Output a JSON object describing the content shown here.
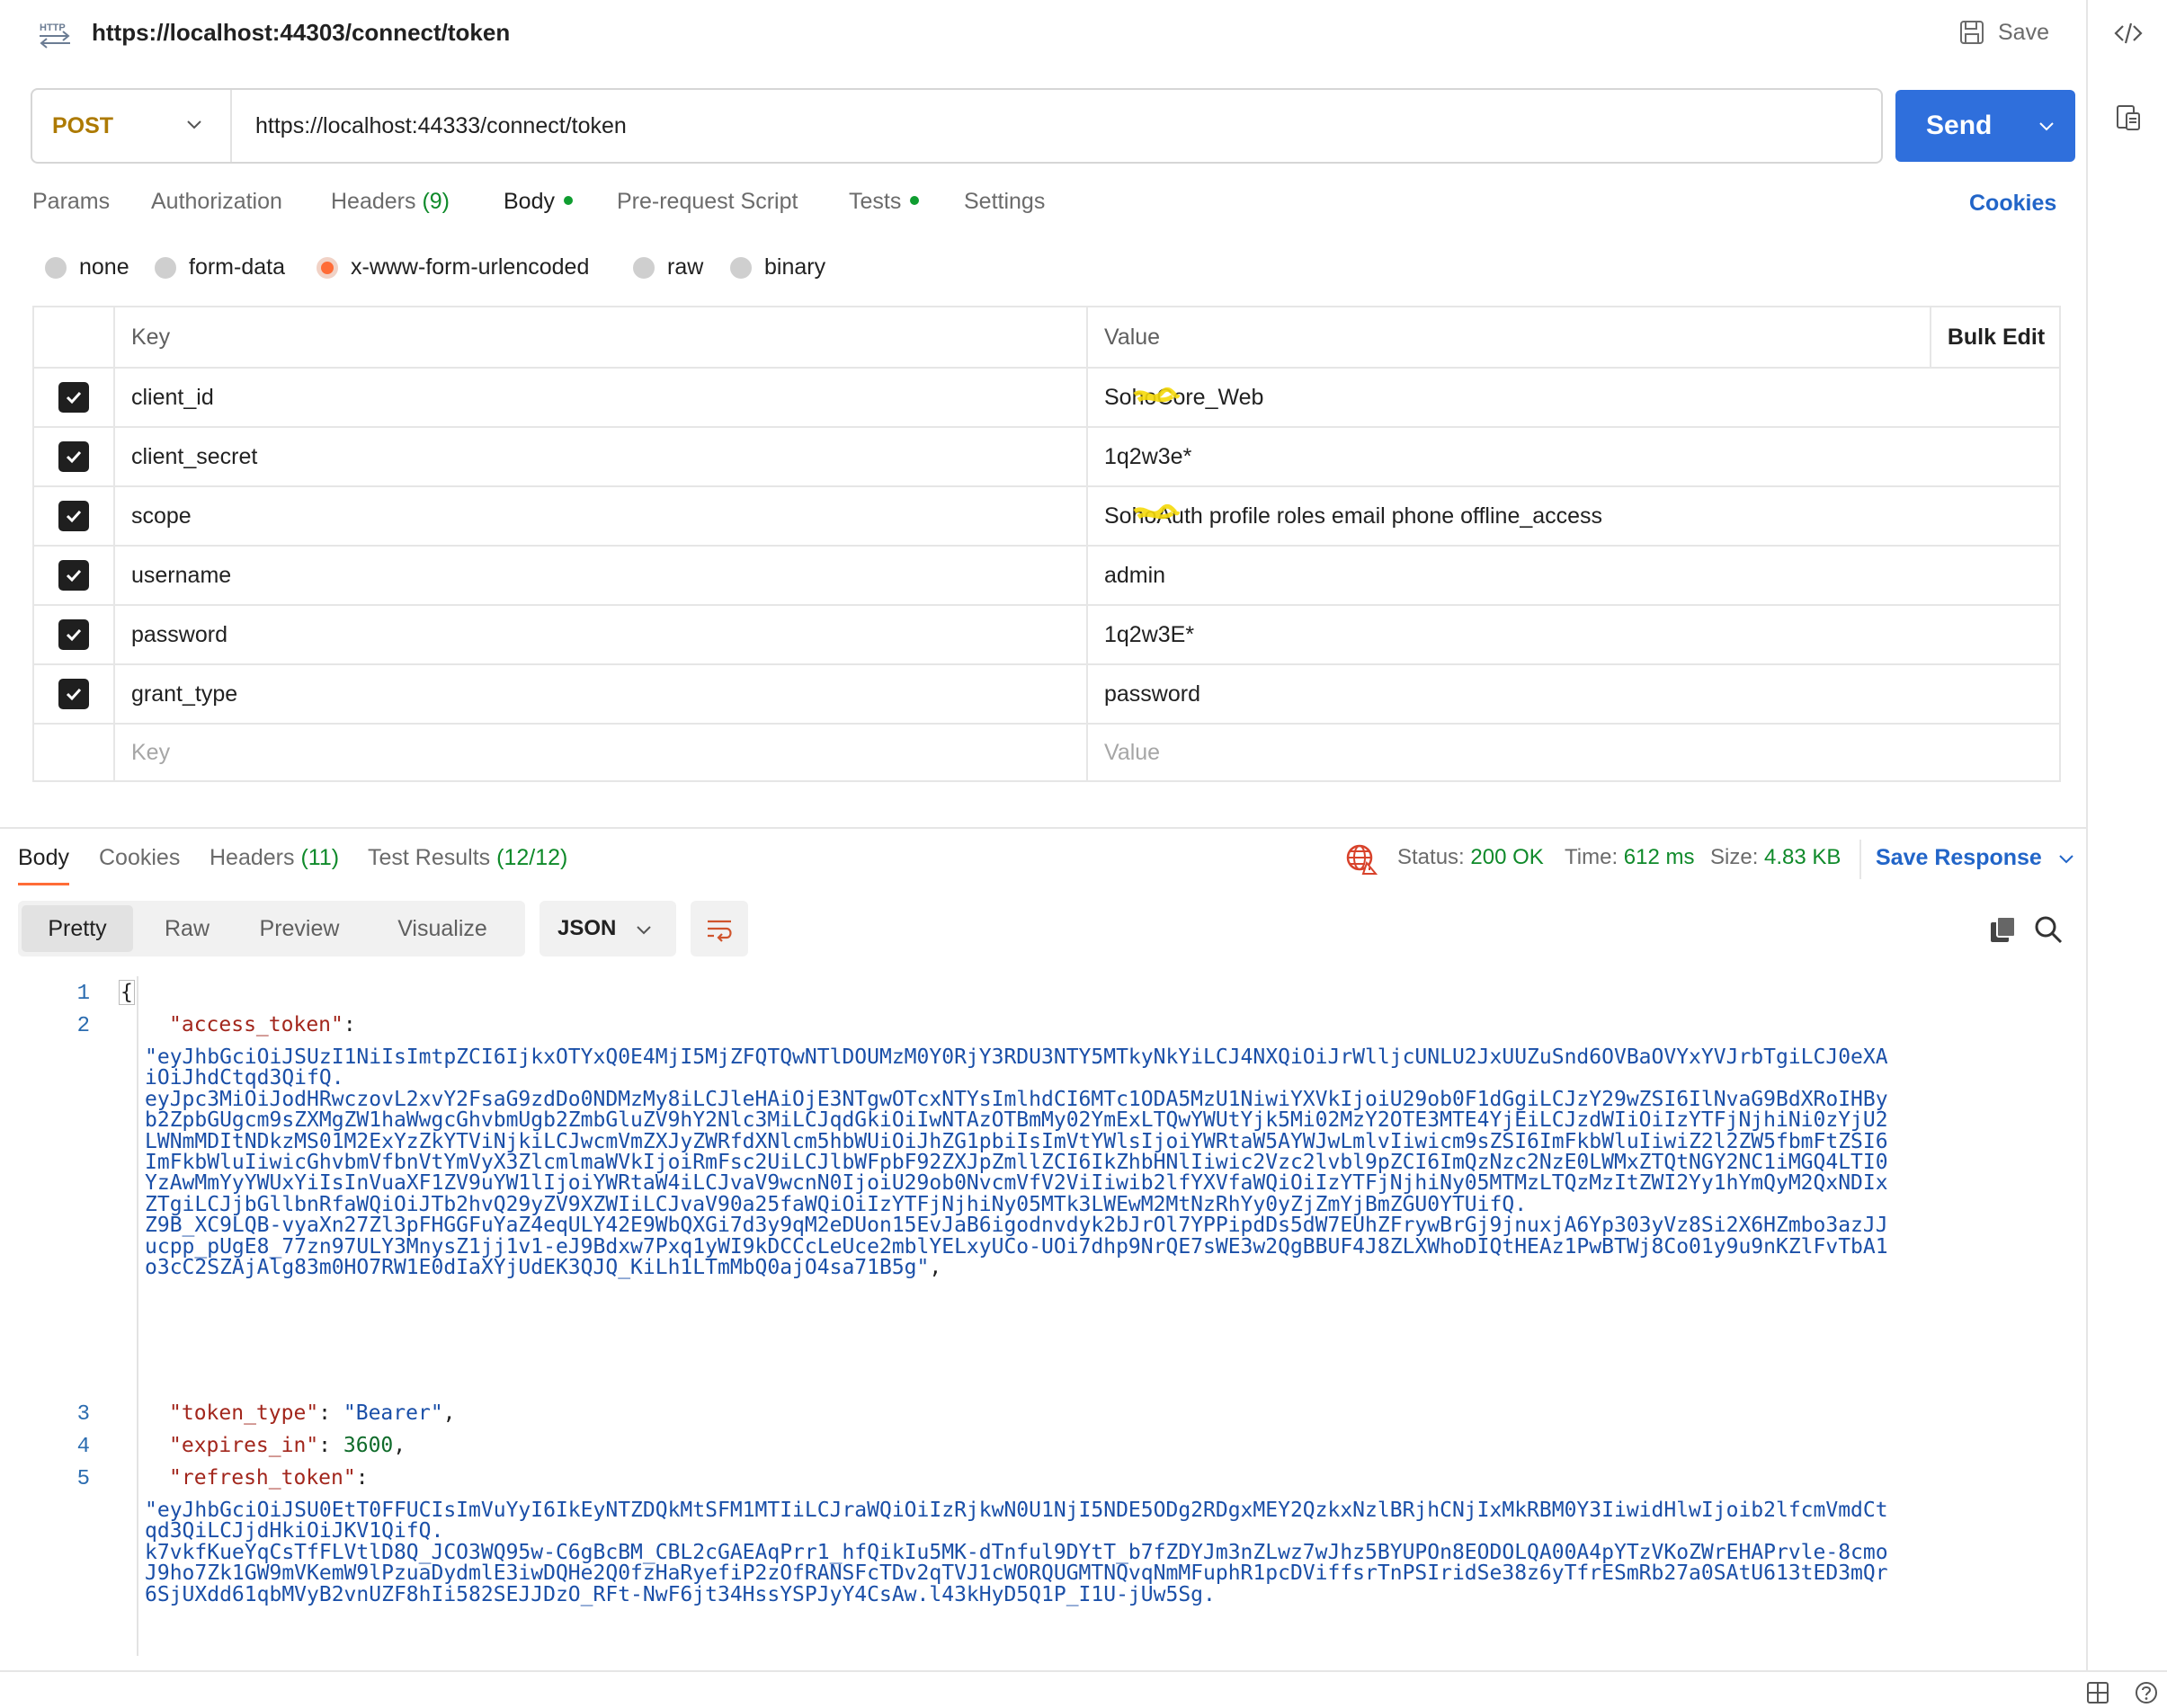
{
  "titlebar": {
    "icon_text": "HTTP",
    "title": "https://localhost:44303/connect/token",
    "save_label": "Save"
  },
  "request": {
    "method": "POST",
    "url": "https://localhost:44333/connect/token",
    "send_label": "Send"
  },
  "tabs": {
    "params": "Params",
    "authorization": "Authorization",
    "headers": "Headers",
    "headers_count": "(9)",
    "body": "Body",
    "prerequest": "Pre-request Script",
    "tests": "Tests",
    "settings": "Settings",
    "cookies": "Cookies"
  },
  "body_types": {
    "none": "none",
    "form_data": "form-data",
    "urlencoded": "x-www-form-urlencoded",
    "raw": "raw",
    "binary": "binary",
    "selected": "x-www-form-urlencoded"
  },
  "kv_table": {
    "key_header": "Key",
    "value_header": "Value",
    "bulk_edit": "Bulk Edit",
    "key_placeholder": "Key",
    "value_placeholder": "Value",
    "rows": [
      {
        "key": "client_id",
        "value": "SohoCore_Web"
      },
      {
        "key": "client_secret",
        "value": "1q2w3e*"
      },
      {
        "key": "scope",
        "value": "SohoAuth profile roles email phone offline_access"
      },
      {
        "key": "username",
        "value": "admin"
      },
      {
        "key": "password",
        "value": "1q2w3E*"
      },
      {
        "key": "grant_type",
        "value": "password"
      }
    ]
  },
  "response": {
    "tabs": {
      "body": "Body",
      "cookies": "Cookies",
      "headers": "Headers",
      "headers_count": "(11)",
      "test_results": "Test Results",
      "test_results_count": "(12/12)"
    },
    "status_label": "Status:",
    "status_value": "200 OK",
    "time_label": "Time:",
    "time_value": "612 ms",
    "size_label": "Size:",
    "size_value": "4.83 KB",
    "save_response": "Save Response",
    "views": {
      "pretty": "Pretty",
      "raw": "Raw",
      "preview": "Preview",
      "visualize": "Visualize"
    },
    "format": "JSON",
    "code": {
      "l1_num": "1",
      "l1": "{",
      "l2_num": "2",
      "access_key": "\"access_token\"",
      "colon": ":",
      "access_lines": [
        "\"eyJhbGciOiJSUzI1NiIsImtpZCI6IjkxOTYxQ0E4MjI5MjZFQTQwNTlDOUMzM0Y0RjY3RDU3NTY5MTkyNkYiLCJ4NXQiOiJrWlljcUNLU2JxUUZuSnd6OVBaOVYxYVJrbTgiLCJ0eXA",
        "iOiJhdCtqd3QifQ.",
        "eyJpc3MiOiJodHRwczovL2xvY2FsaG9zdDo0NDMzMy8iLCJleHAiOjE3NTgwOTcxNTYsImlhdCI6MTc1ODA5MzU1NiwiYXVkIjoiU29ob0F1dGgiLCJzY29wZSI6IlNvaG9BdXRoIHBy",
        "b2ZpbGUgcm9sZXMgZW1haWwgcGhvbmUgb2ZmbGluZV9hY2Nlc3MiLCJqdGkiOiIwNTAzOTBmMy02YmExLTQwYWUtYjk5Mi02MzY2OTE3MTE4YjEiLCJzdWIiOiIzYTFjNjhiNi0zYjU2",
        "LWNmMDItNDkzMS01M2ExYzZkYTViNjkiLCJwcmVmZXJyZWRfdXNlcm5hbWUiOiJhZG1pbiIsImVtYWlsIjoiYWRtaW5AYWJwLmlvIiwicm9sZSI6ImFkbWluIiwiZ2l2ZW5fbmFtZSI6",
        "ImFkbWluIiwicGhvbmVfbnVtYmVyX3ZlcmlmaWVkIjoiRmFsc2UiLCJlbWFpbF92ZXJpZmllZCI6IkZhbHNlIiwic2Vzc2lvbl9pZCI6ImQzNzc2NzE0LWMxZTQtNGY2NC1iMGQ4LTI0",
        "YzAwMmYyYWUxYiIsInVuaXF1ZV9uYW1lIjoiYWRtaW4iLCJvaV9wcnN0IjoiU29ob0NvcmVfV2ViIiwib2lfYXVfaWQiOiIzYTFjNjhiNy05MTMzLTQzMzItZWI2Yy1hYmQyM2QxNDIx",
        "ZTgiLCJjbGllbnRfaWQiOiJTb2hvQ29yZV9XZWIiLCJvaV90a25faWQiOiIzYTFjNjhiNy05MTk3LWEwM2MtNzRhYy0yZjZmYjBmZGU0YTUifQ.",
        "Z9B_XC9LQB-vyaXn27Zl3pFHGGFuYaZ4eqULY42E9WbQXGi7d3y9qM2eDUon15EvJaB6igodnvdyk2bJrOl7YPPipdDs5dW7EUhZFrywBrGj9jnuxjA6Yp303yVz8Si2X6HZmbo3azJJ",
        "ucpp_pUgE8_77zn97ULY3MnysZ1jj1v1-eJ9Bdxw7Pxq1yWI9kDCCcLeUce2mblYELxyUCo-UOi7dhp9NrQE7sWE3w2QgBBUF4J8ZLXWhoDIQtHEAz1PwBTWj8Co01y9u9nKZlFvTbA1",
        "o3cC2SZAjAlg83m0HO7RW1E0dIaXYjUdEK3QJQ_KiLh1LTmMbQ0ajO4sa71B5g\""
      ],
      "comma": ",",
      "l3_num": "3",
      "token_type_key": "\"token_type\"",
      "token_type_val": "\"Bearer\"",
      "l4_num": "4",
      "expires_key": "\"expires_in\"",
      "expires_val": "3600",
      "l5_num": "5",
      "refresh_key": "\"refresh_token\"",
      "refresh_lines": [
        "\"eyJhbGciOiJSU0EtT0FFUCIsImVuYyI6IkEyNTZDQkMtSFM1MTIiLCJraWQiOiIzRjkwN0U1NjI5NDE5ODg2RDgxMEY2QzkxNzlBRjhCNjIxMkRBM0Y3IiwidHlwIjoib2lfcmVmdCt",
        "qd3QiLCJjdHkiOiJKV1QifQ.",
        "k7vkfKueYqCsTfFLVtlD8Q_JCO3WQ95w-C6gBcBM_CBL2cGAEAqPrr1_hfQikIu5MK-dTnful9DYtT_b7fZDYJm3nZLwz7wJhz5BYUPOn8EODOLQA00A4pYTzVKoZWrEHAPrvle-8cmo",
        "J9ho7Zk1GW9mVKemW9lPzuaDydmlE3iwDQHe2Q0fzHaRyefiP2zOfRANSFcTDv2qTVJ1cWORQUGMTNQvqNmMFuphR1pcDViffsrTnPSIridSe38z6yTfrESmRb27a0SAtU613tED3mQr",
        "6SjUXdd61qbMVyB2vnUZF8hIi582SEJJDzO_RFt-NwF6jt34HssYSPJyY4CsAw.l43kHyD5Q1P_I1U-jUw5Sg."
      ]
    }
  },
  "icons": {
    "code_icon": "code-icon",
    "doc_icon": "document-icon",
    "layout_icon": "layout-icon",
    "help_icon": "help-icon",
    "accent_color": "#ff6c37",
    "send_color": "#2f6fdc",
    "link_color": "#2265c8",
    "success_color": "#0f8a2a"
  }
}
